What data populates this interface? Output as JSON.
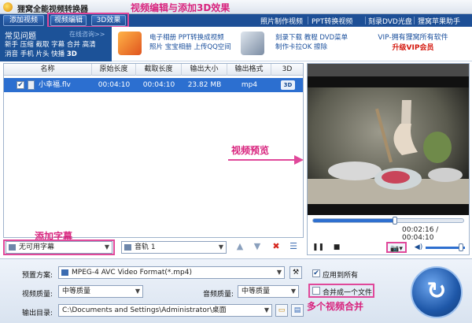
{
  "window": {
    "title": "狸窝全能视频转换器"
  },
  "toolbar": {
    "add_video": "添加视频",
    "edit_video": "视频编辑",
    "effect_3d": "3D效果",
    "right_items": [
      "照片制作视频",
      "PPT转换视频",
      "刻录DVD光盘",
      "狸窝苹果助手"
    ]
  },
  "faq": {
    "title": "常见问题",
    "more": "在线咨询>>",
    "links": [
      "新手",
      "压缩",
      "截取",
      "字幕",
      "合并",
      "高清",
      "消音",
      "手机",
      "片头",
      "快播",
      "3D"
    ]
  },
  "tips": {
    "photo_album": "电子相册  PPT转换成视频",
    "photo_line2": "照片  宝宝相册  上传QQ空间",
    "burn": "刻录下载  教程  DVD菜单",
    "burn_line2": "制作卡拉OK  擦除",
    "vip_line1": "VIP-拥有狸窝所有软件",
    "vip_line2": "升级VIP会员"
  },
  "table": {
    "headers": [
      "名称",
      "原始长度",
      "截取长度",
      "输出大小",
      "输出格式",
      "3D"
    ],
    "rows": [
      {
        "checked": "✔",
        "name": "小幸福.flv",
        "orig_len": "00:04:10",
        "cut_len": "00:04:10",
        "size": "23.82 MB",
        "format": "mp4",
        "mode_3d": "3D"
      }
    ]
  },
  "preview": {
    "time": "00:02:16 / 00:04:10",
    "progress": 0.54,
    "volume": 0.85
  },
  "subtitle_bar": {
    "subtitle_value": "无可用字幕",
    "audio_value": "音轨 1"
  },
  "bottom": {
    "preset_label": "预置方案:",
    "preset_value": "MPEG-4 AVC Video Format(*.mp4)",
    "apply_all": "应用到所有",
    "video_quality_label": "视频质量:",
    "video_quality_value": "中等质量",
    "audio_quality_label": "音频质量:",
    "audio_quality_value": "中等质量",
    "merge_label": "合并成一个文件",
    "output_label": "输出目录:",
    "output_value": "C:\\Documents and Settings\\Administrator\\桌面"
  },
  "annotations": {
    "edit_3d": "视频编辑与添加3D效果",
    "preview": "视频预览",
    "subtitle": "添加字幕",
    "screenshot": "截图",
    "merge": "多个视频合并"
  },
  "colors": {
    "toolbar": "#1d4f96",
    "selected_row": "#2c6fd0",
    "annotation": "#e0489a"
  }
}
